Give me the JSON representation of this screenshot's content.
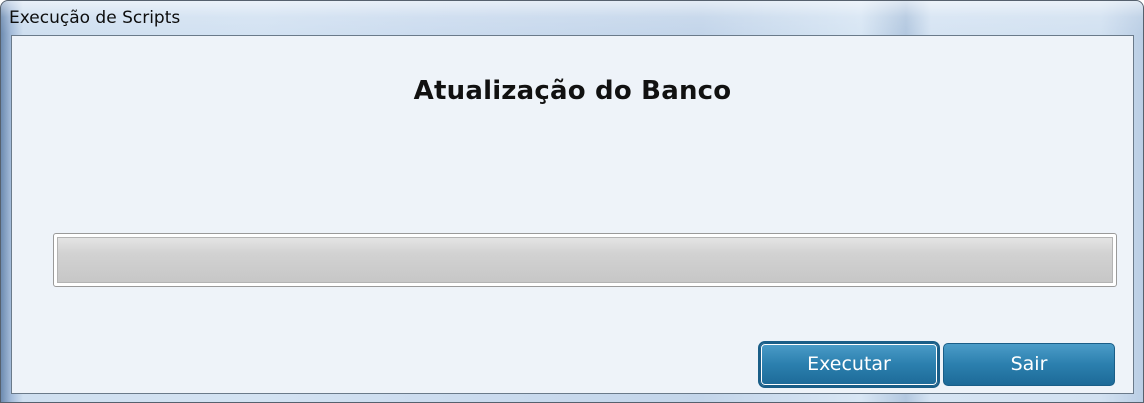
{
  "window": {
    "title": "Execução de Scripts"
  },
  "main": {
    "heading": "Atualização do Banco",
    "progress": {
      "value_percent": 0
    }
  },
  "buttons": {
    "execute_label": "Executar",
    "exit_label": "Sair"
  },
  "colors": {
    "button_accent": "#2b7fae",
    "client_background": "#eef3f9",
    "progress_track": "#cccccc"
  }
}
